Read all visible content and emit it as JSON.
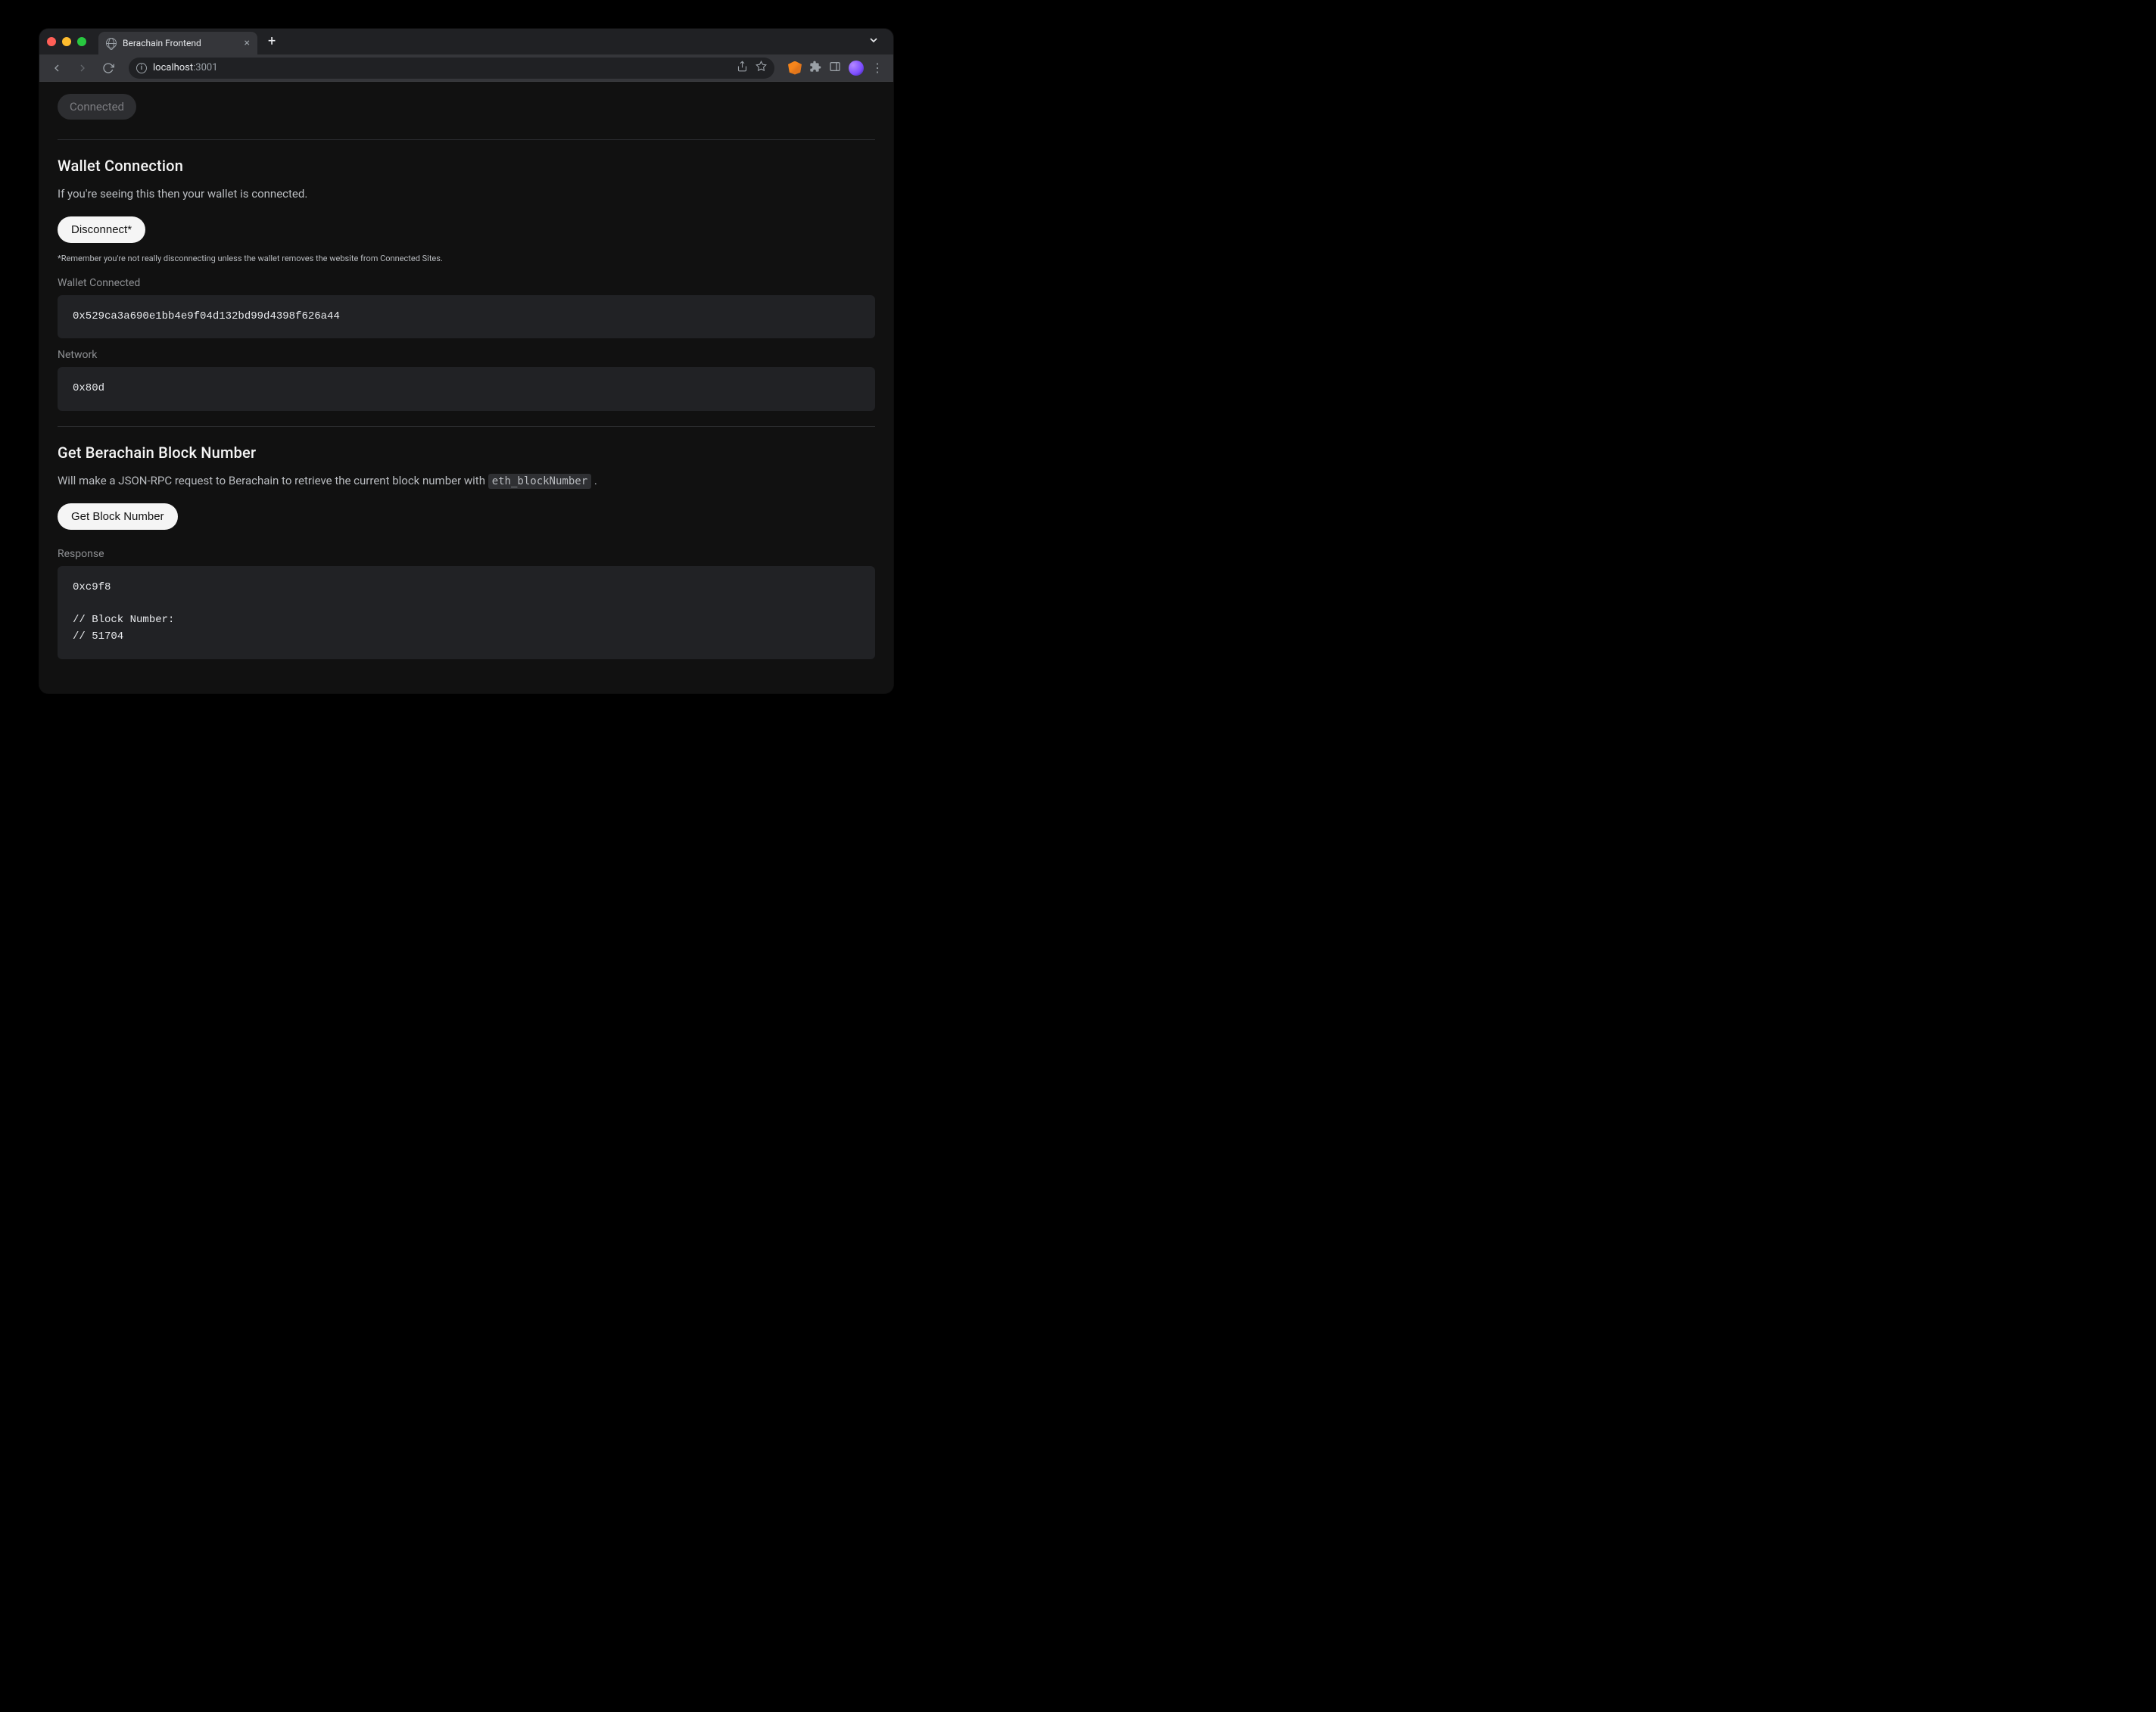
{
  "browser": {
    "tab_title": "Berachain Frontend",
    "url_host": "localhost",
    "url_port": ":3001"
  },
  "header": {
    "chip_label": "Connected"
  },
  "wallet_section": {
    "title": "Wallet Connection",
    "description": "If you're seeing this then your wallet is connected.",
    "disconnect_label": "Disconnect*",
    "fine_print": "*Remember you're not really disconnecting unless the wallet removes the website from Connected Sites.",
    "wallet_label": "Wallet Connected",
    "wallet_address": "0x529ca3a690e1bb4e9f04d132bd99d4398f626a44",
    "network_label": "Network",
    "network_value": "0x80d"
  },
  "block_section": {
    "title": "Get Berachain Block Number",
    "description_prefix": "Will make a JSON-RPC request to Berachain to retrieve the current block number with ",
    "rpc_method": "eth_blockNumber",
    "description_suffix": " .",
    "button_label": "Get Block Number",
    "response_label": "Response",
    "response_body": "0xc9f8\n\n// Block Number:\n// 51704"
  }
}
